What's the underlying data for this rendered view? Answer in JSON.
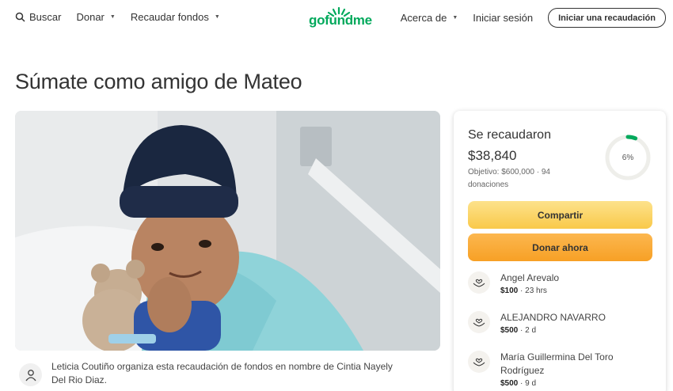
{
  "header": {
    "search_label": "Buscar",
    "donate_label": "Donar",
    "fundraise_label": "Recaudar fondos",
    "logo_text": "gofundme",
    "about_label": "Acerca de",
    "login_label": "Iniciar sesión",
    "start_button": "Iniciar una recaudación"
  },
  "page": {
    "title": "Súmate como amigo de Mateo"
  },
  "organizer": {
    "text": "Leticia Coutiño organiza esta recaudación de fondos en nombre de Cintia Nayely Del Rio Diaz."
  },
  "sidebar": {
    "raised_label": "Se recaudaron",
    "amount": "$38,840",
    "goal_text": "Objetivo: $600,000 · 94 donaciones",
    "progress_percent": 6,
    "progress_label": "6%",
    "share_button": "Compartir",
    "donate_button": "Donar ahora",
    "donations": [
      {
        "name": "Angel Arevalo",
        "amount": "$100",
        "time": " · 23 hrs"
      },
      {
        "name": "ALEJANDRO NAVARRO",
        "amount": "$500",
        "time": " · 2 d"
      },
      {
        "name": "María Guillermina Del Toro Rodríguez",
        "amount": "$500",
        "time": " · 9 d"
      }
    ]
  },
  "colors": {
    "brand_green": "#02a95c",
    "share_yellow": "#f9c94a",
    "donate_orange": "#f7a025"
  },
  "icons": [
    "search-icon",
    "chevron-down-icon",
    "user-icon",
    "heart-hands-icon"
  ]
}
